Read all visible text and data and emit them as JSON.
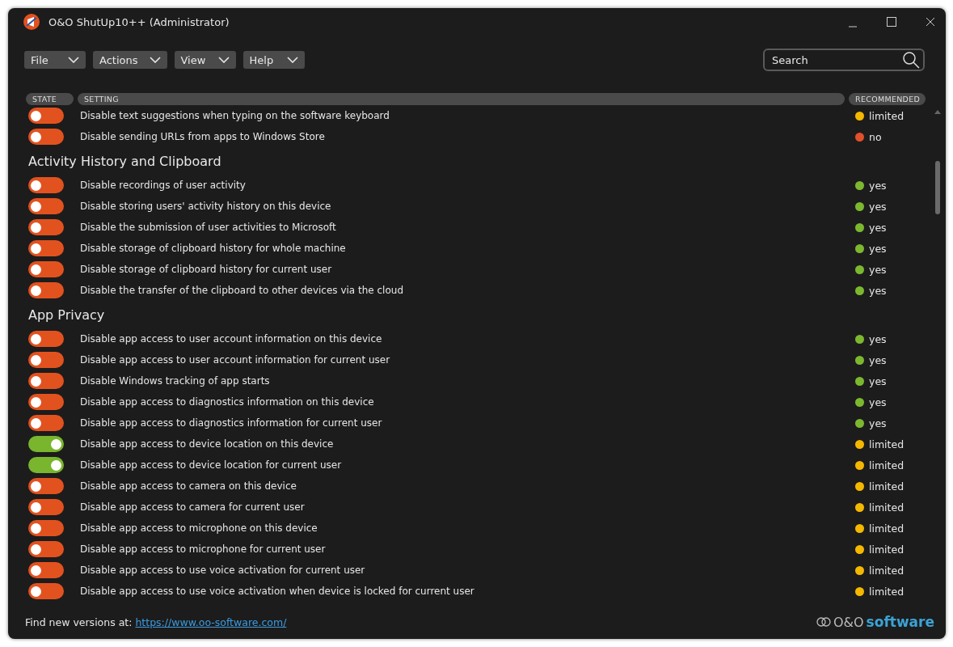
{
  "window": {
    "title": "O&O ShutUp10++ (Administrator)"
  },
  "menus": [
    {
      "label": "File"
    },
    {
      "label": "Actions"
    },
    {
      "label": "View"
    },
    {
      "label": "Help"
    }
  ],
  "search": {
    "placeholder": "Search"
  },
  "columns": [
    "STATE",
    "SETTING",
    "RECOMMENDED"
  ],
  "groups": [
    {
      "rows": [
        {
          "label": "Disable text suggestions when typing on the software keyboard",
          "on": false,
          "recommended": "limited",
          "color": "#f5b800"
        },
        {
          "label": "Disable sending URLs from apps to Windows Store",
          "on": false,
          "recommended": "no",
          "color": "#e0502a"
        }
      ]
    },
    {
      "title": "Activity History and Clipboard",
      "rows": [
        {
          "label": "Disable recordings of user activity",
          "on": false,
          "recommended": "yes",
          "color": "#7cb82f"
        },
        {
          "label": "Disable storing users' activity history on this device",
          "on": false,
          "recommended": "yes",
          "color": "#7cb82f"
        },
        {
          "label": "Disable the submission of user activities to Microsoft",
          "on": false,
          "recommended": "yes",
          "color": "#7cb82f"
        },
        {
          "label": "Disable storage of clipboard history for whole machine",
          "on": false,
          "recommended": "yes",
          "color": "#7cb82f"
        },
        {
          "label": "Disable storage of clipboard history for current user",
          "on": false,
          "recommended": "yes",
          "color": "#7cb82f"
        },
        {
          "label": "Disable the transfer of the clipboard to other devices via the cloud",
          "on": false,
          "recommended": "yes",
          "color": "#7cb82f"
        }
      ]
    },
    {
      "title": "App Privacy",
      "rows": [
        {
          "label": "Disable app access to user account information on this device",
          "on": false,
          "recommended": "yes",
          "color": "#7cb82f"
        },
        {
          "label": "Disable app access to user account information for current user",
          "on": false,
          "recommended": "yes",
          "color": "#7cb82f"
        },
        {
          "label": "Disable Windows tracking of app starts",
          "on": false,
          "recommended": "yes",
          "color": "#7cb82f"
        },
        {
          "label": "Disable app access to diagnostics information on this device",
          "on": false,
          "recommended": "yes",
          "color": "#7cb82f"
        },
        {
          "label": "Disable app access to diagnostics information for current user",
          "on": false,
          "recommended": "yes",
          "color": "#7cb82f"
        },
        {
          "label": "Disable app access to device location on this device",
          "on": true,
          "recommended": "limited",
          "color": "#f5b800"
        },
        {
          "label": "Disable app access to device location for current user",
          "on": true,
          "recommended": "limited",
          "color": "#f5b800"
        },
        {
          "label": "Disable app access to camera on this device",
          "on": false,
          "recommended": "limited",
          "color": "#f5b800"
        },
        {
          "label": "Disable app access to camera for current user",
          "on": false,
          "recommended": "limited",
          "color": "#f5b800"
        },
        {
          "label": "Disable app access to microphone on this device",
          "on": false,
          "recommended": "limited",
          "color": "#f5b800"
        },
        {
          "label": "Disable app access to microphone for current user",
          "on": false,
          "recommended": "limited",
          "color": "#f5b800"
        },
        {
          "label": "Disable app access to use voice activation for current user",
          "on": false,
          "recommended": "limited",
          "color": "#f5b800"
        },
        {
          "label": "Disable app access to use voice activation when device is locked for current user",
          "on": false,
          "recommended": "limited",
          "color": "#f5b800"
        }
      ]
    }
  ],
  "footer": {
    "text": "Find new versions at:",
    "link": "https://www.oo-software.com/",
    "brand_prefix": "O&O",
    "brand": "software"
  }
}
